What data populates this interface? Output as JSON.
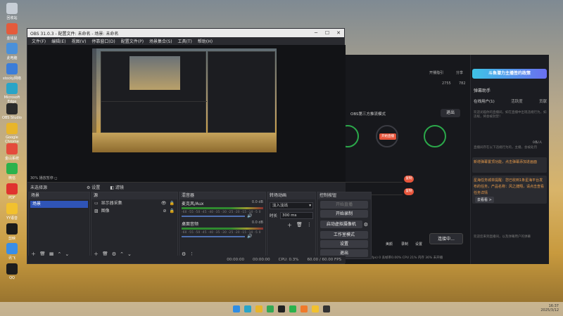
{
  "desktop": {
    "icons": [
      {
        "label": "回收站",
        "color": "#c7ced6"
      },
      {
        "label": "金钱鼠",
        "color": "#e45b3c"
      },
      {
        "label": "此电脑",
        "color": "#4a90d9"
      },
      {
        "label": "stocky网络",
        "color": "#3b7dd8"
      },
      {
        "label": "Microsoft Edge",
        "color": "#2aa4c7"
      },
      {
        "label": "OBS Studio",
        "color": "#2b2b2b"
      },
      {
        "label": "Google Chrome",
        "color": "#e8b52a"
      },
      {
        "label": "金山系统",
        "color": "#e44b3c"
      },
      {
        "label": "微信",
        "color": "#2bb24c"
      },
      {
        "label": "PDF",
        "color": "#e0332f"
      },
      {
        "label": "YY语音",
        "color": "#f2c12e"
      },
      {
        "label": "剪映",
        "color": "#1b1b1b"
      },
      {
        "label": "讯飞",
        "color": "#3a8ee6"
      },
      {
        "label": "QQ",
        "color": "#1d1d1d"
      }
    ]
  },
  "obs": {
    "title": "OBS 31.0.3 - 配置文件: 未命名 - 场景: 未命名",
    "menu": [
      "文件(F)",
      "编辑(E)",
      "视图(V)",
      "停靠窗口(D)",
      "配置文件(P)",
      "场景集合(S)",
      "工具(T)",
      "帮助(H)"
    ],
    "zoom_text": "30%  播放暂停 ◻",
    "scenebar": {
      "source_label": "未选择源",
      "props_label": "⚙ 设置",
      "filters_label": "◧ 滤镜"
    },
    "scenes": {
      "header": "场景",
      "items": [
        "场景"
      ]
    },
    "sources": {
      "header": "源",
      "items": [
        "显示器采集",
        "图像"
      ]
    },
    "mixer": {
      "header": "混音器",
      "channels": [
        {
          "name": "麦克风/Aux",
          "db": "0.0 dB"
        },
        {
          "name": "桌面音频",
          "db": "0.0 dB"
        }
      ],
      "scale": "-60 -55 -50 -45 -40 -35 -30 -25 -20 -15 -10 -5 0"
    },
    "transitions": {
      "header": "转场动画",
      "type": "淡入淡出",
      "duration_label": "时长",
      "duration": "300 ms"
    },
    "controls": {
      "header": "控制按钮",
      "buttons": [
        "开始直播",
        "开始录制",
        "启动虚拟摄像机",
        "工作室模式",
        "设置",
        "退出"
      ]
    },
    "status": {
      "stream_time": "00:00:00",
      "rec_time": "00:00:00",
      "cpu": "CPU: 0.3%",
      "fps": "60.00 / 60.00 FPS"
    }
  },
  "live": {
    "mode": "OBS第三方推流模式",
    "exit_label": "退出",
    "start_label": "开始直播",
    "stream_label": "复制",
    "connect_label": "连接中...",
    "bottom": [
      "美颜",
      "录制",
      "设置"
    ],
    "stats": "码率(kb/s)   0    帧率(fps)   0   丢帧率0.00%   CPU 21%   内存 36%   未开播",
    "top": [
      "开播指引",
      "分享"
    ],
    "likes": "2755",
    "viewers": "782"
  },
  "panel": {
    "banner": "斗鱼潜力主播签约政策",
    "title": "弹幕助手",
    "tabs": [
      "在线用户(1)",
      "活跃度",
      "贡献"
    ],
    "count": "0条/人",
    "messages": [
      "欢迎光临你的直播间，如在直播中出现违规行为，如违规，将会被封禁！",
      "直播间存在以下违规行为的，主播，会被处罚",
      "新增弹幕置顶功能，点击弹幕添加进画面",
      "星海任务城单提醒：您已收到1条星海平台发布的任务，产品名称：风之捷翔，请点击查看任务详情",
      "去看看 >"
    ],
    "footer_msg": "欢迎您来到直播间，以及弹幕用户的弹幕"
  },
  "taskbar": {
    "icons": [
      {
        "name": "start-icon",
        "color": "#2f8de4"
      },
      {
        "name": "edge-icon",
        "color": "#2aa4c7"
      },
      {
        "name": "chrome-icon",
        "color": "#e8b52a"
      },
      {
        "name": "arrow-icon",
        "color": "#34a853"
      },
      {
        "name": "obs-icon",
        "color": "#222"
      },
      {
        "name": "wechat-icon",
        "color": "#2bb24c"
      },
      {
        "name": "douyu-icon",
        "color": "#f07a2a"
      },
      {
        "name": "explorer-icon",
        "color": "#f2c12e"
      },
      {
        "name": "dark-icon",
        "color": "#333"
      }
    ],
    "clock_time": "16:37",
    "clock_date": "2025/3/12"
  }
}
